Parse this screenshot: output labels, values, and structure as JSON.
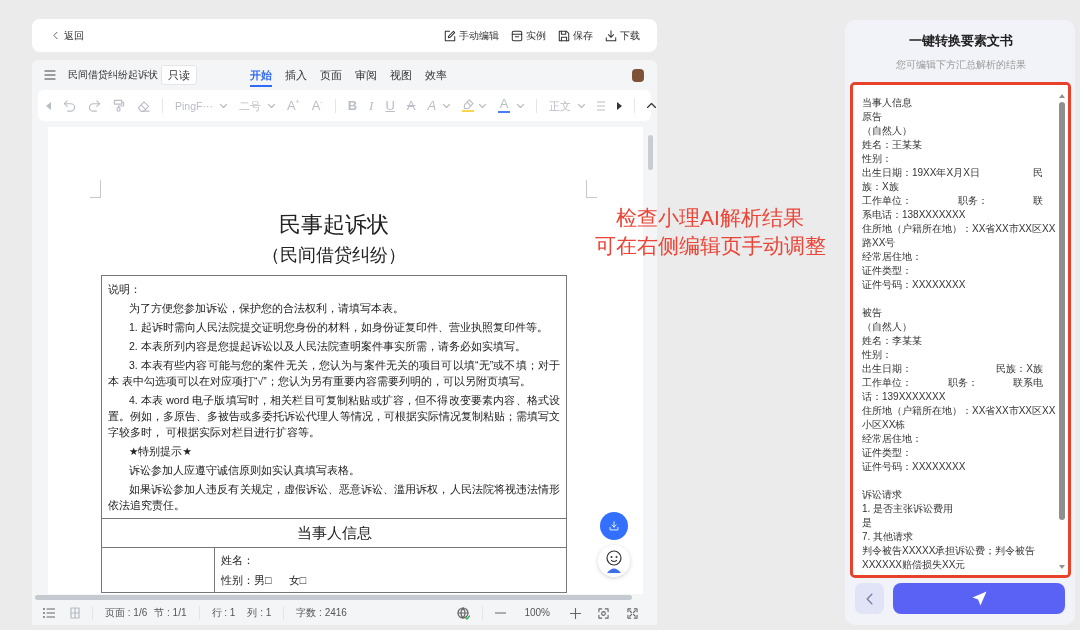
{
  "top_bar": {
    "back": "返回",
    "actions": [
      {
        "kind": "edit",
        "label": "手动编辑"
      },
      {
        "kind": "example",
        "label": "实例"
      },
      {
        "kind": "save",
        "label": "保存"
      },
      {
        "kind": "download",
        "label": "下载"
      }
    ]
  },
  "editor": {
    "document_name": "民间借贷纠纷起诉状",
    "badge": "只读",
    "tabs": [
      {
        "label": "开始",
        "selected": true
      },
      {
        "label": "插入",
        "selected": false
      },
      {
        "label": "页面",
        "selected": false
      },
      {
        "label": "审阅",
        "selected": false
      },
      {
        "label": "视图",
        "selected": false
      },
      {
        "label": "效率",
        "selected": false
      }
    ],
    "toolbar": {
      "groups": [
        [
          {
            "kind": "scroll-left",
            "disabled": true
          },
          {
            "kind": "undo",
            "disabled": true
          },
          {
            "kind": "redo",
            "disabled": true
          },
          {
            "kind": "painter",
            "disabled": true
          },
          {
            "kind": "eraser",
            "disabled": true
          }
        ],
        [
          {
            "kind": "font-family",
            "label": "PingF···",
            "disabled": true
          },
          {
            "kind": "font-size",
            "label": "二号",
            "disabled": true
          },
          {
            "kind": "grow-font",
            "label": "A$^{+}$",
            "disabled": true
          },
          {
            "kind": "shrink-font",
            "label": "A$^{-}$",
            "disabled": true
          }
        ],
        [
          {
            "kind": "bold",
            "label": "B",
            "disabled": true
          },
          {
            "kind": "italic",
            "label": "I",
            "disabled": true
          },
          {
            "kind": "underline",
            "label": "U",
            "disabled": true
          },
          {
            "kind": "strike",
            "label": "A",
            "disabled": true
          },
          {
            "kind": "effect",
            "label": "A",
            "disabled": true
          },
          {
            "kind": "highlight",
            "color": "#f7d54c",
            "disabled": true
          },
          {
            "kind": "font-color",
            "label": "A",
            "color": "#4a7cf3",
            "disabled": true
          }
        ],
        [
          {
            "kind": "paragraph-style",
            "label": "正文",
            "disabled": true
          },
          {
            "kind": "align",
            "disabled": true
          },
          {
            "kind": "scroll-right",
            "disabled": false
          }
        ],
        [
          {
            "kind": "collapse",
            "disabled": false
          }
        ]
      ]
    },
    "document": {
      "title": "民事起诉状",
      "subtitle": "（民间借贷纠纷）",
      "notes_heading": "说明：",
      "notes": [
        "为了方便您参加诉讼，保护您的合法权利，请填写本表。",
        "1. 起诉时需向人民法院提交证明您身份的材料，如身份证复印件、营业执照复印件等。",
        "2. 本表所列内容是您提起诉讼以及人民法院查明案件事实所需，请务必如实填写。",
        "3. 本表有些内容可能与您的案件无关，您认为与案件无关的项目可以填“无”或不填；对于本 表中勾选项可以在对应项打“√”；您认为另有重要内容需要列明的，可以另附页填写。",
        "4. 本表 word 电子版填写时，相关栏目可复制粘贴或扩容，但不得改变要素内容、格式设置。例如，多原告、多被告或多委托诉讼代理人等情况，可根据实际情况复制粘贴；需填写文字较多时， 可根据实际对栏目进行扩容等。",
        "★特别提示★",
        "诉讼参加人应遵守诚信原则如实认真填写表格。",
        "如果诉讼参加人违反有关规定，虚假诉讼、恶意诉讼、滥用诉权，人民法院将视违法情形依法追究责任。"
      ],
      "section_heading": "当事人信息",
      "party_fields": [
        "姓名：",
        "性别：男□      女□"
      ]
    },
    "status_bar": {
      "page": "页面 : 1/6",
      "section": "节 : 1/1",
      "row": "行 : 1",
      "column": "列 : 1",
      "word_count": "字数 : 2416",
      "zoom": "100%"
    }
  },
  "summary_panel": {
    "title": "一键转换要素文书",
    "subtitle": "您可编辑下方汇总解析的结果",
    "sections": [
      {
        "lines": [
          [
            "当事人信息"
          ],
          [
            "原告"
          ],
          [
            "（自然人）"
          ],
          [
            "姓名：王某某"
          ],
          [
            "性别："
          ],
          [
            "出生日期：19XX年X月X日",
            "民"
          ],
          [
            "族：X族"
          ],
          [
            "工作单位：",
            "职务：",
            "联"
          ],
          [
            "系电话：138XXXXXXX"
          ],
          [
            "住所地（户籍所在地）：XX省XX市XX区XX"
          ],
          [
            "路XX号"
          ],
          [
            "经常居住地："
          ],
          [
            "证件类型："
          ],
          [
            "证件号码：XXXXXXXX"
          ]
        ]
      },
      {
        "lines": [
          [
            "被告"
          ],
          [
            "（自然人）"
          ],
          [
            "姓名：李某某"
          ],
          [
            "性别："
          ],
          [
            "出生日期：",
            "民族：X族"
          ],
          [
            "工作单位：",
            "职务：",
            "联系电"
          ],
          [
            "话：139XXXXXXX"
          ],
          [
            "住所地（户籍所在地）：XX省XX市XX区XX"
          ],
          [
            "小区XX栋"
          ],
          [
            "经常居住地："
          ],
          [
            "证件类型："
          ],
          [
            "证件号码：XXXXXXXX"
          ]
        ]
      },
      {
        "lines": [
          [
            "诉讼请求"
          ],
          [
            "1. 是否主张诉讼费用"
          ],
          [
            "是"
          ],
          [
            "7. 其他请求"
          ],
          [
            "判令被告XXXXX承担诉讼费；判令被告"
          ],
          [
            "XXXXXX赔偿损失XX元"
          ]
        ]
      }
    ]
  },
  "annotation": {
    "lines": [
      "检查小理AI解析结果",
      "可在右侧编辑页手动调整"
    ]
  }
}
